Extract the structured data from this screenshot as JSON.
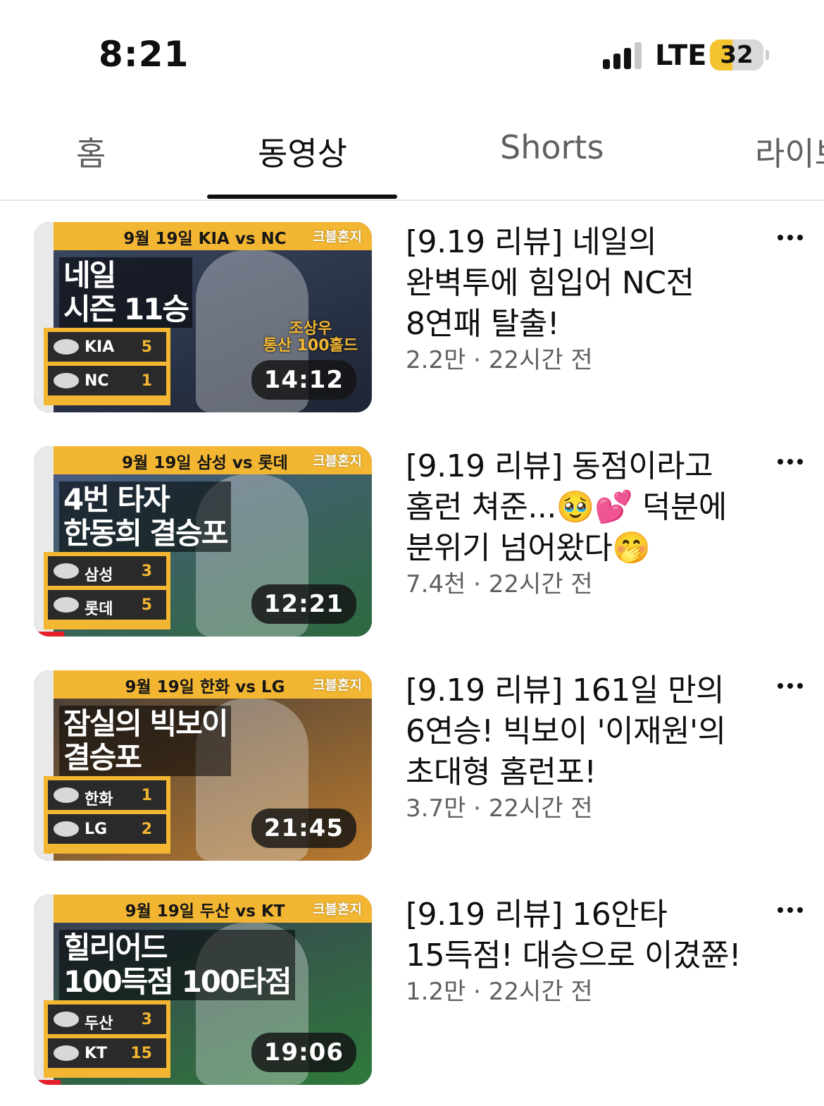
{
  "status_bar": {
    "time": "8:21",
    "network": "LTE",
    "battery": "32",
    "battery_level": 0.32,
    "signal_bars_active": 3
  },
  "tabs": [
    {
      "label": "홈",
      "active": false
    },
    {
      "label": "동영상",
      "active": true
    },
    {
      "label": "Shorts",
      "active": false
    },
    {
      "label": "라이브",
      "active": false
    }
  ],
  "videos": [
    {
      "title": "[9.19 리뷰] 네일의 완벽투에 힘입어 NC전 8연패 탈출!",
      "meta": "2.2만 · 22시간 전",
      "duration": "14:12",
      "thumb": {
        "date_line": "9월 19일 KIA vs NC",
        "brand": "크블혼지",
        "headline": [
          "네일",
          "시즌 11승"
        ],
        "callout": [
          "조상우",
          "통산 100홀드"
        ],
        "teams": [
          {
            "name": "KIA",
            "score": "5"
          },
          {
            "name": "NC",
            "score": "1"
          }
        ],
        "bg_colors": [
          "#3a4660",
          "#1d2433"
        ],
        "watched_fraction": 0
      }
    },
    {
      "title": "[9.19 리뷰] 동점이라고 홈런 쳐준...🥹💕 덕분에 분위기 넘어왔다🤭",
      "meta": "7.4천 · 22시간 전",
      "duration": "12:21",
      "thumb": {
        "date_line": "9월 19일 삼성 vs 롯데",
        "brand": "크블혼지",
        "headline": [
          "4번 타자",
          "한동희 결승포"
        ],
        "callout": [],
        "teams": [
          {
            "name": "삼성",
            "score": "3"
          },
          {
            "name": "롯데",
            "score": "5"
          }
        ],
        "bg_colors": [
          "#4a5a82",
          "#2d6a3f"
        ],
        "watched_fraction": 0.09
      }
    },
    {
      "title": "[9.19 리뷰] 161일 만의 6연승! 빅보이 '이재원'의 초대형 홈런포!",
      "meta": "3.7만 · 22시간 전",
      "duration": "21:45",
      "thumb": {
        "date_line": "9월 19일 한화 vs LG",
        "brand": "크블혼지",
        "headline": [
          "잠실의 빅보이",
          "결승포"
        ],
        "callout": [],
        "teams": [
          {
            "name": "한화",
            "score": "1"
          },
          {
            "name": "LG",
            "score": "2"
          }
        ],
        "bg_colors": [
          "#4b4038",
          "#b8792e"
        ],
        "watched_fraction": 0
      }
    },
    {
      "title": "[9.19 리뷰] 16안타 15득점! 대승으로 이겼쮼!",
      "meta": "1.2만 · 22시간 전",
      "duration": "19:06",
      "thumb": {
        "date_line": "9월 19일 두산 vs KT",
        "brand": "크블혼지",
        "headline": [
          "힐리어드",
          "100득점 100타점"
        ],
        "callout": [],
        "teams": [
          {
            "name": "두산",
            "score": "3"
          },
          {
            "name": "KT",
            "score": "15"
          }
        ],
        "bg_colors": [
          "#3b3f56",
          "#2e7a3a"
        ],
        "watched_fraction": 0.08
      }
    }
  ]
}
